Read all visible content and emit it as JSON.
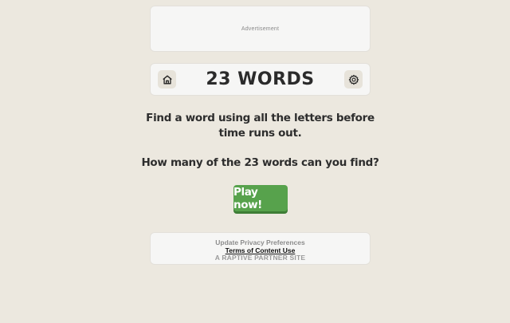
{
  "ad": {
    "label": "Advertisement"
  },
  "header": {
    "title": "23 WORDS",
    "home_icon": "home-icon",
    "settings_icon": "gear-icon"
  },
  "main": {
    "intro": "Find a word using all the letters before time runs out.",
    "question": "How many of the 23 words can you find?",
    "play_label": "Play now!",
    "play_color": "#57a24c"
  },
  "footer": {
    "privacy": "Update Privacy Preferences",
    "terms": "Terms of Content Use",
    "partner": "A RAPTIVE PARTNER SITE"
  },
  "colors": {
    "background": "#ece8df",
    "panel": "#f6f6f5"
  }
}
